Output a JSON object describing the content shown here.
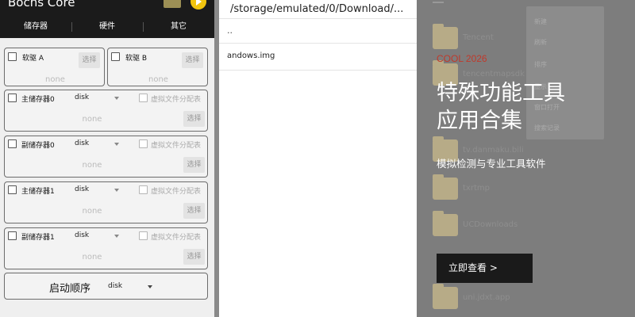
{
  "left_app": {
    "title": "Bochs Core",
    "tabs": [
      "储存器",
      "硬件",
      "其它"
    ],
    "floppy": [
      {
        "label": "软驱 A",
        "button": "选择",
        "path": "none"
      },
      {
        "label": "软驱 B",
        "button": "选择",
        "path": "none"
      }
    ],
    "drives": [
      {
        "label": "主储存器0",
        "type": "disk",
        "vfs": "虚拟文件分配表",
        "button": "选择",
        "path": "none"
      },
      {
        "label": "副储存器0",
        "type": "disk",
        "vfs": "虚拟文件分配表",
        "button": "选择",
        "path": "none"
      },
      {
        "label": "主储存器1",
        "type": "disk",
        "vfs": "虚拟文件分配表",
        "button": "选择",
        "path": "none"
      },
      {
        "label": "副储存器1",
        "type": "disk",
        "vfs": "虚拟文件分配表",
        "button": "选择",
        "path": "none"
      }
    ],
    "boot": {
      "label": "启动顺序",
      "value": "disk"
    }
  },
  "file_browser": {
    "path": "/storage/emulated/0/Download/...",
    "parent": "..",
    "items": [
      "andows.img"
    ]
  },
  "file_manager": {
    "folders": [
      "Tencent",
      "tencentmapsdk",
      "tv.danmaku.bili",
      "txrtmp",
      "UCDownloads",
      "uni.jdxt.app"
    ],
    "menu_items": [
      "新建",
      "刷新",
      "排序",
      "显示",
      "窗口打开",
      "搜索记录"
    ]
  },
  "ad": {
    "tag": "COOL 2026",
    "title": "特殊功能工具应用合集",
    "subtitle": "模拟检测与专业工具软件",
    "button": "立即查看 >"
  },
  "colors": {
    "accent": "#c0392b",
    "header": "#1b1b1b",
    "button_bg": "#1a1a1a"
  }
}
